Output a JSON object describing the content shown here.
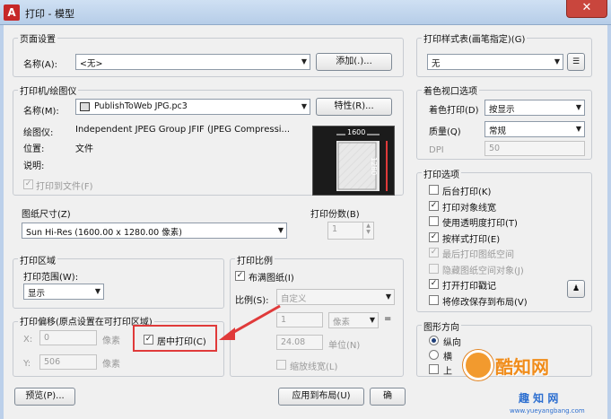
{
  "window": {
    "app_icon": "A",
    "title": "打印 - 模型",
    "close": "✕"
  },
  "page_setup": {
    "title": "页面设置",
    "name_label": "名称(A):",
    "name_value": "<无>",
    "add_button": "添加(.)..."
  },
  "plotter": {
    "title": "打印机/绘图仪",
    "name_label": "名称(M):",
    "name_value": "PublishToWeb JPG.pc3",
    "properties_button": "特性(R)...",
    "plotter_label": "绘图仪:",
    "plotter_value": "Independent JPEG Group JFIF (JPEG Compressi...",
    "where_label": "位置:",
    "where_value": "文件",
    "desc_label": "说明:",
    "plot_to_file": "打印到文件(F)",
    "preview_width": "1600",
    "preview_height": "1280"
  },
  "paper_size": {
    "title": "图纸尺寸(Z)",
    "value": "Sun Hi-Res (1600.00 x 1280.00 像素)"
  },
  "copies": {
    "title": "打印份数(B)",
    "value": "1"
  },
  "plot_area": {
    "title": "打印区域",
    "range_label": "打印范围(W):",
    "range_value": "显示"
  },
  "plot_scale": {
    "title": "打印比例",
    "fit_paper": "布满图纸(I)",
    "scale_label": "比例(S):",
    "scale_value": "自定义",
    "num_value": "1",
    "unit_value": "像素",
    "equals": "=",
    "den_value": "24.08",
    "unit_label": "单位(N)",
    "scale_lineweights": "缩放线宽(L)"
  },
  "plot_offset": {
    "title": "打印偏移(原点设置在可打印区域)",
    "x_label": "X:",
    "x_value": "0",
    "x_unit": "像素",
    "y_label": "Y:",
    "y_value": "506",
    "y_unit": "像素",
    "center_plot": "居中打印(C)"
  },
  "plot_style": {
    "title": "打印样式表(画笔指定)(G)",
    "value": "无"
  },
  "shaded_viewport": {
    "title": "着色视口选项",
    "shade_label": "着色打印(D)",
    "shade_value": "按显示",
    "quality_label": "质量(Q)",
    "quality_value": "常规",
    "dpi_label": "DPI",
    "dpi_value": "50"
  },
  "plot_options": {
    "title": "打印选项",
    "items": [
      {
        "label": "后台打印(K)",
        "checked": false,
        "disabled": false
      },
      {
        "label": "打印对象线宽",
        "checked": true,
        "disabled": false
      },
      {
        "label": "使用透明度打印(T)",
        "checked": false,
        "disabled": false
      },
      {
        "label": "按样式打印(E)",
        "checked": true,
        "disabled": false
      },
      {
        "label": "最后打印图纸空间",
        "checked": true,
        "disabled": true
      },
      {
        "label": "隐藏图纸空间对象(J)",
        "checked": false,
        "disabled": true
      },
      {
        "label": "打开打印戳记",
        "checked": true,
        "disabled": false
      },
      {
        "label": "将修改保存到布局(V)",
        "checked": false,
        "disabled": false
      }
    ]
  },
  "orientation": {
    "title": "图形方向",
    "portrait": "纵向",
    "landscape": "横",
    "upside_down": "上"
  },
  "footer": {
    "preview_button": "预览(P)...",
    "apply_button": "应用到布局(U)",
    "ok_button": "确"
  },
  "watermark": {
    "logo_text": "酷知网",
    "sub_text": "趣 知 网",
    "url": "www.yueyangbang.com"
  }
}
